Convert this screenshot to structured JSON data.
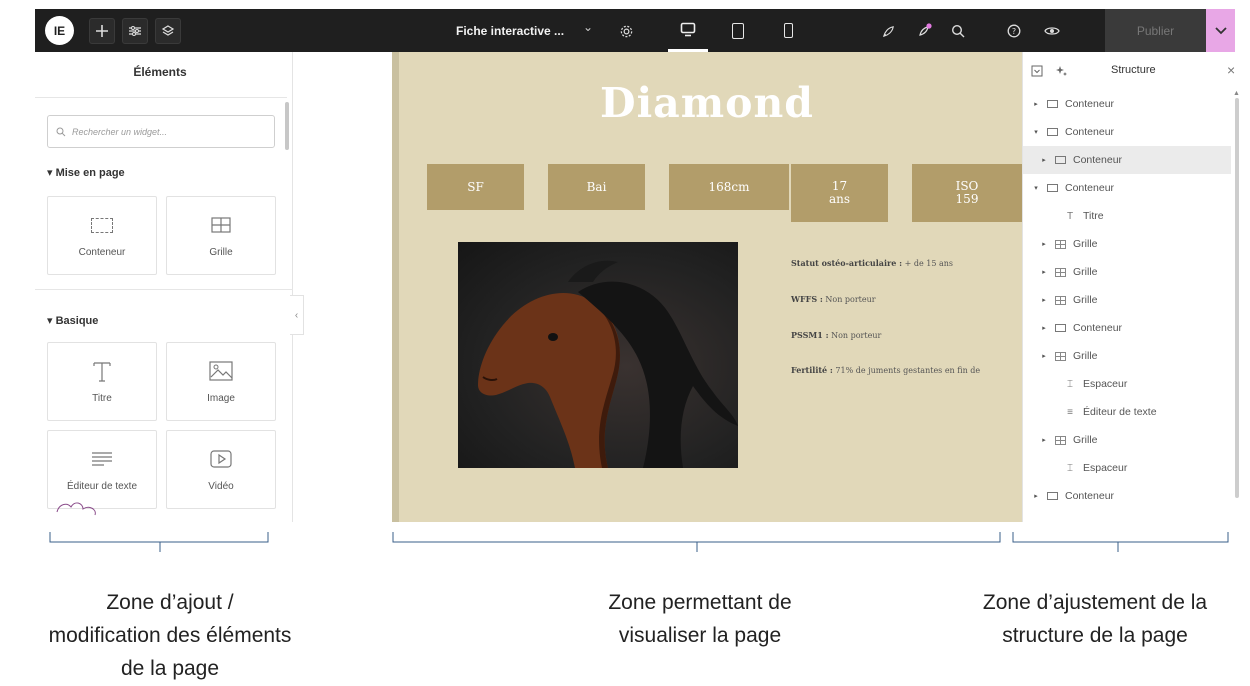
{
  "topbar": {
    "logo_text": "IE",
    "doc_name": "Fiche interactive ...",
    "publish_label": "Publier",
    "colors": {
      "bar": "#1f1f1f",
      "accent": "#e8a7e6",
      "notification": "#e27ae0"
    },
    "icons": [
      "plus-icon",
      "settings-sliders-icon",
      "layers-icon",
      "gear-icon",
      "desktop-icon",
      "tablet-icon",
      "mobile-icon",
      "rocket-icon",
      "notifications-icon",
      "search-icon",
      "help-icon",
      "preview-eye-icon",
      "chevron-down-icon"
    ]
  },
  "left_panel": {
    "title": "Éléments",
    "search_placeholder": "Rechercher un widget...",
    "sections": [
      {
        "label": "Mise en page",
        "widgets": [
          "Conteneur",
          "Grille"
        ]
      },
      {
        "label": "Basique",
        "widgets": [
          "Titre",
          "Image",
          "Éditeur de texte",
          "Vidéo"
        ]
      }
    ]
  },
  "canvas": {
    "heading": "Diamond",
    "boxes": [
      "SF",
      "Bai",
      "168cm",
      "17",
      "ans",
      "ISO",
      "159"
    ],
    "stats": [
      {
        "label": "Statut ostéo-articulaire :",
        "value": " + de 15 ans"
      },
      {
        "label": "WFFS :",
        "value": " Non porteur"
      },
      {
        "label": "PSSM1 :",
        "value": " Non porteur"
      },
      {
        "label": "Fertilité :",
        "value": " 71% de juments gestantes en fin de"
      }
    ],
    "colors": {
      "background": "#e1d8b9",
      "box": "#b29d6a"
    }
  },
  "right_panel": {
    "title": "Structure",
    "tree": [
      {
        "label": "Conteneur",
        "arrow": "▸"
      },
      {
        "label": "Conteneur",
        "arrow": "▾"
      },
      {
        "label": "Conteneur",
        "arrow": "▸"
      },
      {
        "label": "Conteneur",
        "arrow": "▾"
      },
      {
        "label": "Titre",
        "arrow": ""
      },
      {
        "label": "Grille",
        "arrow": "▸"
      },
      {
        "label": "Grille",
        "arrow": "▸"
      },
      {
        "label": "Grille",
        "arrow": "▸"
      },
      {
        "label": "Conteneur",
        "arrow": "▸"
      },
      {
        "label": "Grille",
        "arrow": "▸"
      },
      {
        "label": "Espaceur",
        "arrow": ""
      },
      {
        "label": "Éditeur de texte",
        "arrow": ""
      },
      {
        "label": "Grille",
        "arrow": "▸"
      },
      {
        "label": "Espaceur",
        "arrow": ""
      },
      {
        "label": "Conteneur",
        "arrow": "▸"
      }
    ]
  },
  "annotations": {
    "left": [
      "Zone d’ajout /",
      "modification des éléments",
      "de la page"
    ],
    "middle": [
      "Zone permettant de",
      "visualiser la page"
    ],
    "right": [
      "Zone d’ajustement de la",
      "structure de la page"
    ]
  }
}
